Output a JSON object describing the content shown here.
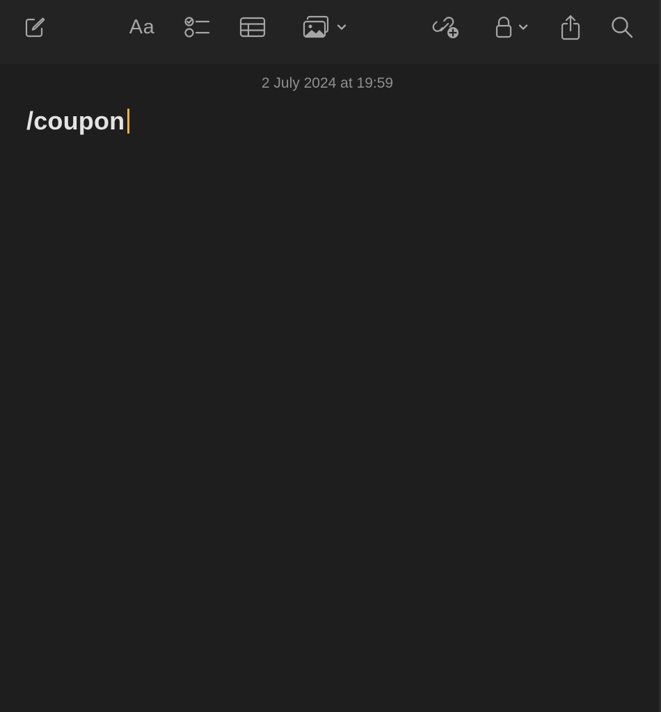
{
  "toolbar": {
    "compose_icon": "compose-icon",
    "format_label": "Aa",
    "checklist_icon": "checklist-icon",
    "table_icon": "table-icon",
    "media_icon": "photo-icon",
    "collaborate_icon": "collaborate-icon",
    "lock_icon": "lock-icon",
    "share_icon": "share-icon",
    "search_icon": "search-icon"
  },
  "note": {
    "date": "2 July 2024 at 19:59",
    "title": "/coupon"
  },
  "colors": {
    "background": "#1e1e1e",
    "toolbar": "#232323",
    "icon": "#a6a6a6",
    "caret": "#f2b33d",
    "text": "#e3e3e3"
  }
}
